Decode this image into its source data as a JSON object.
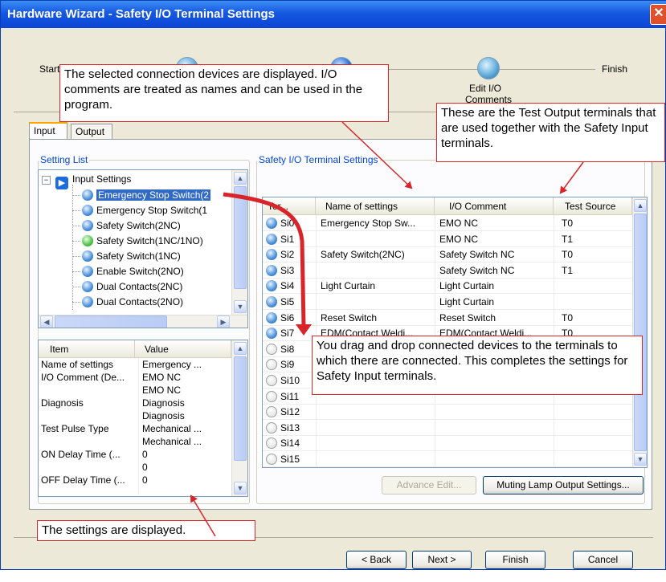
{
  "window": {
    "title": "Hardware Wizard - Safety I/O Terminal Settings",
    "close_glyph": "✕"
  },
  "steps": {
    "start": "Start",
    "edit_io": "Edit I/O",
    "edit_io_2": "Comments",
    "finish": "Finish"
  },
  "tabs": {
    "input": "Input",
    "output": "Output"
  },
  "setting_list": {
    "legend": "Setting List",
    "root": "Input Settings",
    "items": [
      {
        "label": "Emergency Stop Switch(2",
        "icon": "blue-ball-icon"
      },
      {
        "label": "Emergency Stop Switch(1",
        "icon": "blue-ball-icon"
      },
      {
        "label": "Safety Switch(2NC)",
        "icon": "blue-ball-icon"
      },
      {
        "label": "Safety Switch(1NC/1NO)",
        "icon": "green-ball-icon"
      },
      {
        "label": "Safety Switch(1NC)",
        "icon": "blue-ball-icon"
      },
      {
        "label": "Enable Switch(2NO)",
        "icon": "blue-ball-icon"
      },
      {
        "label": "Dual Contacts(2NC)",
        "icon": "blue-ball-icon"
      },
      {
        "label": "Dual Contacts(2NO)",
        "icon": "blue-ball-icon"
      }
    ]
  },
  "properties": {
    "headers": [
      "Item",
      "Value"
    ],
    "rows": [
      [
        "Name of settings",
        "Emergency ..."
      ],
      [
        "I/O Comment (De...",
        "EMO NC"
      ],
      [
        "",
        "EMO NC"
      ],
      [
        "Diagnosis",
        "Diagnosis"
      ],
      [
        "",
        "Diagnosis"
      ],
      [
        "Test Pulse Type",
        "Mechanical ..."
      ],
      [
        "",
        "Mechanical ..."
      ],
      [
        "ON Delay Time (...",
        "0"
      ],
      [
        "",
        "0"
      ],
      [
        "OFF Delay Time (...",
        "0"
      ]
    ]
  },
  "terminal_settings": {
    "legend": "Safety I/O Terminal Settings",
    "headers": [
      "Ter...",
      "Name of settings",
      "I/O Comment",
      "Test Source"
    ],
    "rows": [
      [
        "Si0",
        "Emergency Stop Sw...",
        "EMO NC",
        "T0"
      ],
      [
        "Si1",
        "",
        "EMO NC",
        "T1"
      ],
      [
        "Si2",
        "Safety Switch(2NC)",
        "Safety Switch NC",
        "T0"
      ],
      [
        "Si3",
        "",
        "Safety Switch NC",
        "T1"
      ],
      [
        "Si4",
        "Light Curtain",
        "Light Curtain",
        ""
      ],
      [
        "Si5",
        "",
        "Light Curtain",
        ""
      ],
      [
        "Si6",
        "Reset Switch",
        "Reset Switch",
        "T0"
      ],
      [
        "Si7",
        "EDM(Contact Weldi...",
        "EDM(Contact Weldi...",
        "T0"
      ],
      [
        "Si8",
        "",
        "",
        ""
      ],
      [
        "Si9",
        "",
        "",
        ""
      ],
      [
        "Si10",
        "",
        "",
        ""
      ],
      [
        "Si11",
        "",
        "",
        ""
      ],
      [
        "Si12",
        "",
        "",
        ""
      ],
      [
        "Si13",
        "",
        "",
        ""
      ],
      [
        "Si14",
        "",
        "",
        ""
      ],
      [
        "Si15",
        "",
        "",
        ""
      ]
    ],
    "advance_edit": "Advance Edit...",
    "muting_lamp": "Muting Lamp Output Settings..."
  },
  "footer": {
    "back": "< Back",
    "next": "Next >",
    "finish": "Finish",
    "cancel": "Cancel"
  },
  "callouts": {
    "selected": "The selected connection devices are displayed. I/O comments are treated as names and can be used in the program.",
    "test_output": "These are the Test Output terminals that are used together with the Safety Input terminals.",
    "drag_drop": "You drag and drop connected devices to the terminals to which there are connected. This completes the settings for Safety Input terminals.",
    "settings": "The settings are displayed."
  },
  "colors": {
    "callout_border": "#d9252a",
    "title_bar": "#1557e0",
    "selection": "#316ac5"
  }
}
